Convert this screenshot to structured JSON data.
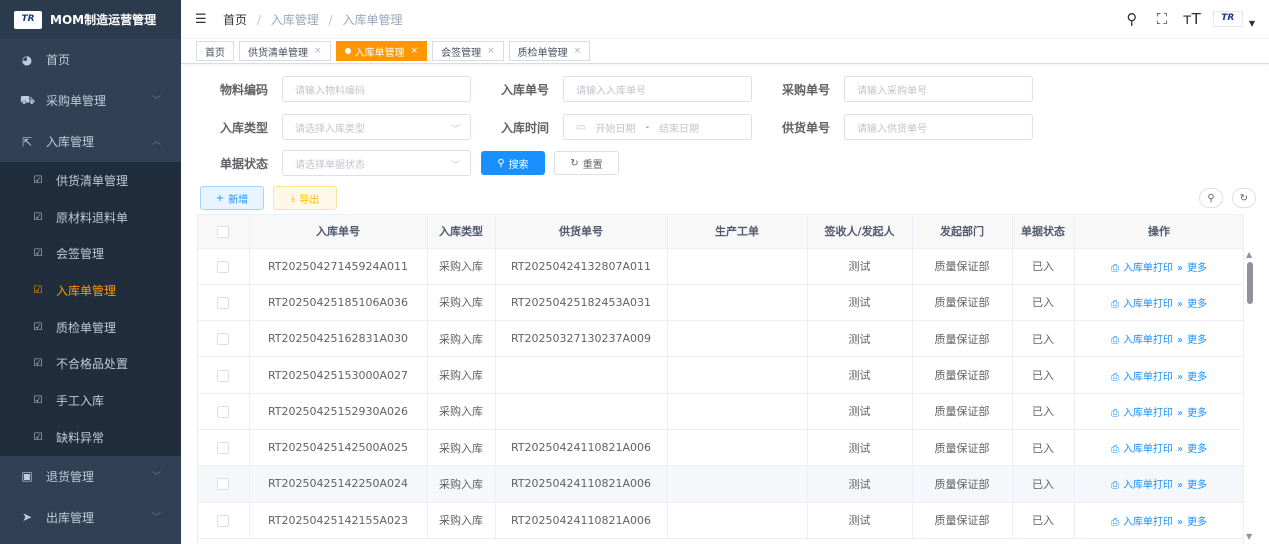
{
  "app": {
    "logo_text": "TR",
    "title": "MOM制造运营管理"
  },
  "sidebar": {
    "top_items": [
      {
        "label": "首页",
        "icon": "dashboard-icon"
      },
      {
        "label": "采购单管理",
        "icon": "cart-icon"
      },
      {
        "label": "入库管理",
        "icon": "inbound-icon"
      }
    ],
    "sub_items": [
      {
        "label": "供货清单管理"
      },
      {
        "label": "原材料退料单"
      },
      {
        "label": "会签管理"
      },
      {
        "label": "入库单管理",
        "active": true
      },
      {
        "label": "质检单管理"
      },
      {
        "label": "不合格品处置"
      },
      {
        "label": "手工入库"
      },
      {
        "label": "缺料异常"
      }
    ],
    "bottom_items": [
      {
        "label": "退货管理",
        "icon": "return-icon"
      },
      {
        "label": "出库管理",
        "icon": "outbound-icon"
      }
    ]
  },
  "header": {
    "breadcrumb": [
      "首页",
      "入库管理",
      "入库单管理"
    ],
    "avatar_text": "TR"
  },
  "tags": [
    {
      "label": "首页",
      "closable": false
    },
    {
      "label": "供货清单管理",
      "closable": true
    },
    {
      "label": "入库单管理",
      "closable": true,
      "active": true
    },
    {
      "label": "会签管理",
      "closable": true
    },
    {
      "label": "质检单管理",
      "closable": true
    }
  ],
  "search": {
    "material_code_label": "物料编码",
    "material_code_placeholder": "请输入物料编码",
    "inbound_no_label": "入库单号",
    "inbound_no_placeholder": "请输入入库单号",
    "purchase_no_label": "采购单号",
    "purchase_no_placeholder": "请输入采购单号",
    "inbound_type_label": "入库类型",
    "inbound_type_placeholder": "请选择入库类型",
    "inbound_time_label": "入库时间",
    "start_date_placeholder": "开始日期",
    "date_sep": "-",
    "end_date_placeholder": "结束日期",
    "supply_no_label": "供货单号",
    "supply_no_placeholder": "请输入供货单号",
    "status_label": "单据状态",
    "status_placeholder": "请选择单据状态",
    "search_btn": "搜索",
    "reset_btn": "重置"
  },
  "toolbar": {
    "add_btn": "新增",
    "export_btn": "导出"
  },
  "table": {
    "columns": [
      "入库单号",
      "入库类型",
      "供货单号",
      "生产工单",
      "签收人/发起人",
      "发起部门",
      "单据状态",
      "操作"
    ],
    "op_print": "入库单打印",
    "op_more": "更多",
    "rows": [
      {
        "no": "RT20250427145924A011",
        "type": "采购入库",
        "supply": "RT20250424132807A011",
        "wo": "",
        "signer": "测试",
        "dept": "质量保证部",
        "status": "已入"
      },
      {
        "no": "RT20250425185106A036",
        "type": "采购入库",
        "supply": "RT20250425182453A031",
        "wo": "",
        "signer": "测试",
        "dept": "质量保证部",
        "status": "已入"
      },
      {
        "no": "RT20250425162831A030",
        "type": "采购入库",
        "supply": "RT20250327130237A009",
        "wo": "",
        "signer": "测试",
        "dept": "质量保证部",
        "status": "已入"
      },
      {
        "no": "RT20250425153000A027",
        "type": "采购入库",
        "supply": "",
        "wo": "",
        "signer": "测试",
        "dept": "质量保证部",
        "status": "已入"
      },
      {
        "no": "RT20250425152930A026",
        "type": "采购入库",
        "supply": "",
        "wo": "",
        "signer": "测试",
        "dept": "质量保证部",
        "status": "已入"
      },
      {
        "no": "RT20250425142500A025",
        "type": "采购入库",
        "supply": "RT20250424110821A006",
        "wo": "",
        "signer": "测试",
        "dept": "质量保证部",
        "status": "已入"
      },
      {
        "no": "RT20250425142250A024",
        "type": "采购入库",
        "supply": "RT20250424110821A006",
        "wo": "",
        "signer": "测试",
        "dept": "质量保证部",
        "status": "已入",
        "highlight": true
      },
      {
        "no": "RT20250425142155A023",
        "type": "采购入库",
        "supply": "RT20250424110821A006",
        "wo": "",
        "signer": "测试",
        "dept": "质量保证部",
        "status": "已入"
      }
    ]
  },
  "colors": {
    "sidebar_bg": "#304156",
    "submenu_bg": "#1f2d3d",
    "accent_orange": "#ff9800",
    "primary_blue": "#1890ff"
  }
}
